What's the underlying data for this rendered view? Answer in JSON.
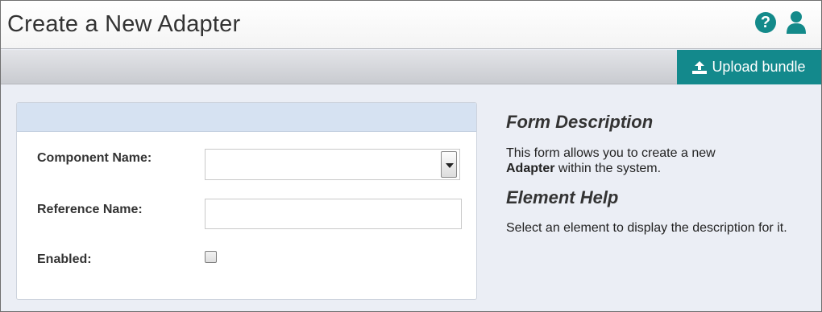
{
  "header": {
    "title": "Create a New Adapter",
    "help_icon": "question-circle-icon",
    "help_glyph": "?",
    "user_icon": "user-icon",
    "accent_color": "#13898c"
  },
  "toolbar": {
    "upload_label": "Upload bundle",
    "upload_icon": "upload-icon"
  },
  "form": {
    "fields": [
      {
        "label": "Component Name:",
        "type": "select",
        "value": ""
      },
      {
        "label": "Reference Name:",
        "type": "text",
        "value": ""
      },
      {
        "label": "Enabled:",
        "type": "checkbox",
        "checked": false
      }
    ]
  },
  "description": {
    "form_heading": "Form Description",
    "form_text_pre": "This form allows you to create a new ",
    "form_text_bold": "Adapter",
    "form_text_post": " within the system.",
    "help_heading": "Element Help",
    "help_text": "Select an element to display the description for it."
  }
}
